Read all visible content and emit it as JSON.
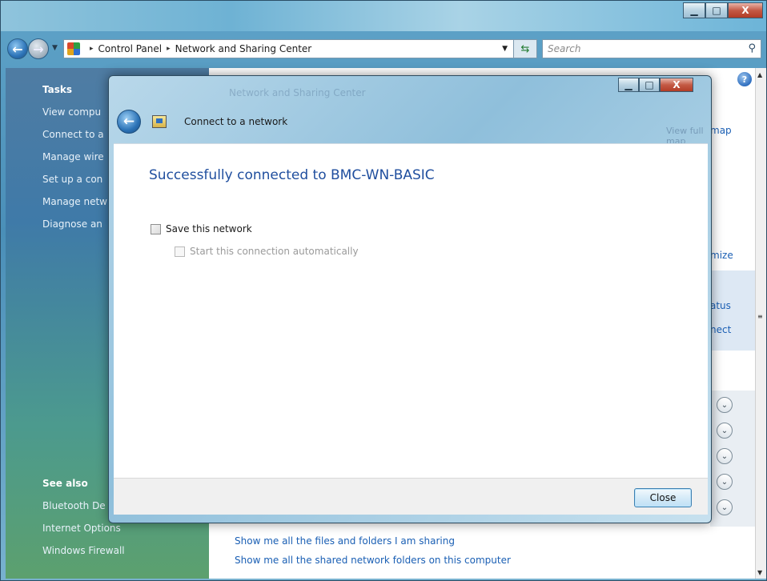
{
  "window": {
    "controls": {
      "minimize": "▁",
      "maximize": "□",
      "close": "X"
    }
  },
  "address": {
    "breadcrumbs": [
      "Control Panel",
      "Network and Sharing Center"
    ],
    "separator": "▸",
    "search_placeholder": "Search"
  },
  "tasks_pane": {
    "title": "Tasks",
    "items": [
      "View compu",
      "Connect to a",
      "Manage wire",
      "Set up a con",
      "Manage netw",
      "Diagnose an"
    ],
    "see_also_title": "See also",
    "see_also_items": [
      "Bluetooth De",
      "Internet Options",
      "Windows Firewall"
    ]
  },
  "main": {
    "side_fragments": [
      "map",
      "mize",
      "atus",
      "nect"
    ],
    "bottom_links": [
      "Show me all the files and folders I am sharing",
      "Show me all the shared network folders on this computer"
    ]
  },
  "dialog": {
    "ghost_title": "Network and Sharing Center",
    "ghost_link": "View full map",
    "title": "Connect to a network",
    "heading": "Successfully connected to BMC-WN-BASIC",
    "save_network_label": "Save this network",
    "start_auto_label": "Start this connection automatically",
    "close_label": "Close"
  },
  "icons": {
    "help": "?",
    "chevron": "⌄",
    "search": "⚲",
    "refresh": "⇆",
    "back": "←",
    "forward": "→",
    "dropdown": "▼"
  },
  "colors": {
    "link": "#1a5fb4",
    "heading": "#1f4e9e",
    "task_pane_top": "#4f7ca3",
    "task_pane_bottom": "#5ca06e"
  }
}
